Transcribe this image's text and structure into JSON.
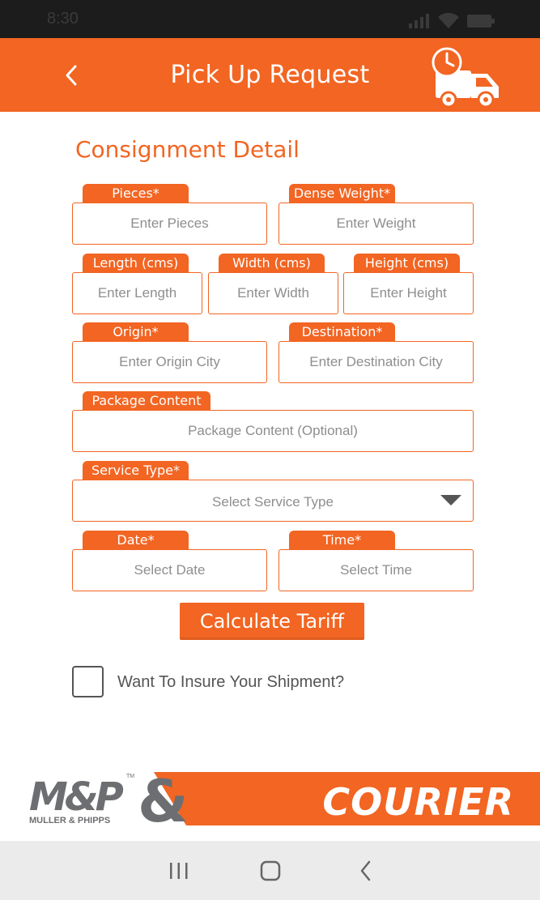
{
  "status_bar": {
    "time": "8:30",
    "icons": [
      "signal-icon",
      "wifi-icon",
      "battery-icon"
    ]
  },
  "header": {
    "title": "Pick Up Request",
    "back_icon": "chevron-left-icon",
    "logo_icon": "delivery-truck-clock-icon"
  },
  "form": {
    "section_title": "Consignment Detail",
    "pieces": {
      "label": "Pieces*",
      "placeholder": "Enter Pieces"
    },
    "dense_weight": {
      "label": "Dense Weight*",
      "placeholder": "Enter Weight"
    },
    "length": {
      "label": "Length (cms)",
      "placeholder": "Enter Length"
    },
    "width": {
      "label": "Width (cms)",
      "placeholder": "Enter Width"
    },
    "height": {
      "label": "Height (cms)",
      "placeholder": "Enter Height"
    },
    "origin": {
      "label": "Origin*",
      "placeholder": "Enter Origin City"
    },
    "destination": {
      "label": "Destination*",
      "placeholder": "Enter Destination City"
    },
    "package_content": {
      "label": "Package Content",
      "placeholder": "Package Content (Optional)"
    },
    "service_type": {
      "label": "Service Type*",
      "placeholder": "Select Service Type"
    },
    "date": {
      "label": "Date*",
      "placeholder": "Select Date"
    },
    "time": {
      "label": "Time*",
      "placeholder": "Select Time"
    },
    "calculate_button": "Calculate Tariff",
    "insure_label": "Want To Insure Your Shipment?"
  },
  "brand": {
    "logo_text": "M&P",
    "logo_subtext": "MULLER & PHIPPS",
    "trademark": "TM",
    "courier_text": "COURIER"
  },
  "nav_bar": {
    "icons": [
      "recent-apps-icon",
      "home-icon",
      "back-icon"
    ]
  },
  "colors": {
    "accent": "#f26522",
    "status_bar": "#1c1c1c",
    "nav_bar": "#ebebeb",
    "text_gray": "#555555",
    "placeholder_gray": "#8e8e8e",
    "logo_gray": "#6d6e71"
  }
}
